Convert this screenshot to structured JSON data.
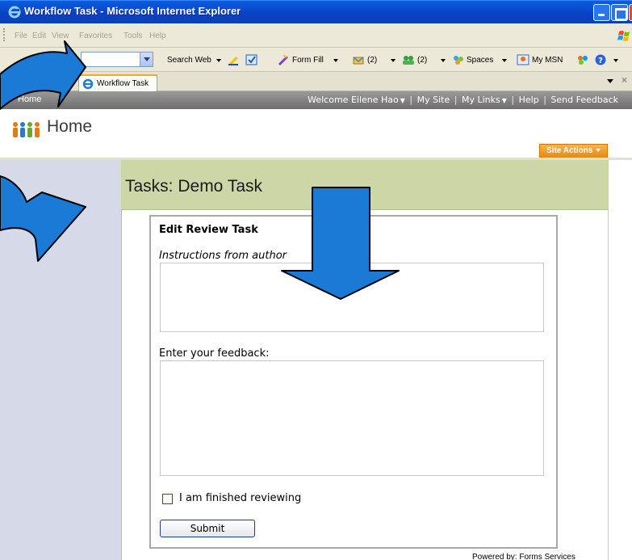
{
  "window": {
    "title": "Workflow Task - Microsoft Internet Explorer"
  },
  "menubar": {
    "items": [
      "File",
      "Edit",
      "View",
      "Favorites",
      "Tools",
      "Help"
    ]
  },
  "toolbar": {
    "search_label": "Search Web",
    "form_fill_label": "Form Fill",
    "mail_count": "(2)",
    "contacts_count": "(2)",
    "spaces_label": "Spaces",
    "mymsn_label": "My MSN"
  },
  "browser_tab": {
    "label": "Workflow Task"
  },
  "sharepoint": {
    "breadcrumb": "Home",
    "welcome": "Welcome Eilene Hao",
    "my_site": "My Site",
    "my_links": "My Links",
    "help": "Help",
    "send_feedback": "Send Feedback",
    "site_title": "Home",
    "site_actions": "Site Actions",
    "page_title": "Tasks: Demo Task",
    "powered_by": "Powered by: Forms Services"
  },
  "form": {
    "heading": "Edit Review Task",
    "instructions_label": "Instructions from author",
    "instructions_value": "",
    "feedback_label": "Enter your feedback:",
    "feedback_value": "",
    "finished_label": "I am finished reviewing",
    "finished_checked": false,
    "submit_label": "Submit"
  },
  "colors": {
    "title_band": "#ccd6a6",
    "site_actions": "#e8880f",
    "arrow": "#1a7ad6",
    "left_nav": "#d6d9e8"
  },
  "annotations": {
    "arrows": [
      "curved-arrow-top-left",
      "curved-arrow-left",
      "down-arrow-center"
    ]
  }
}
